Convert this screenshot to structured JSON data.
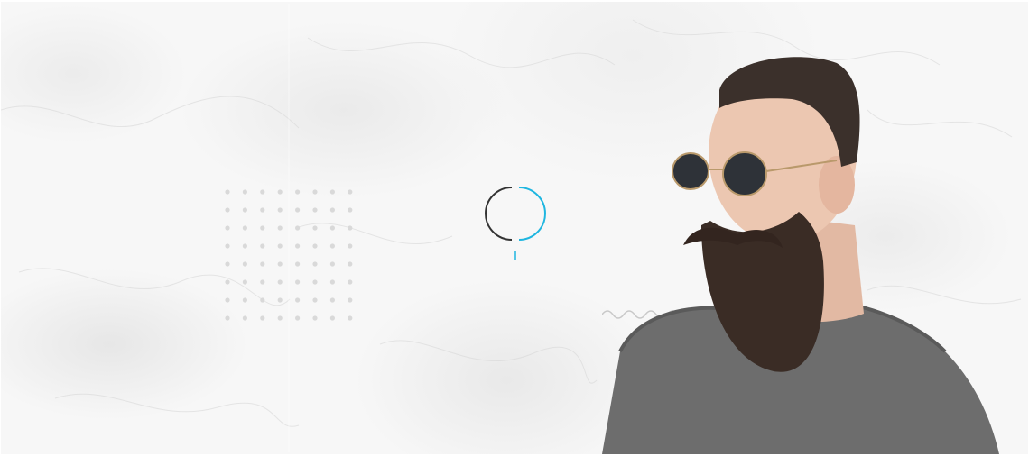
{
  "hero": {
    "accent_color": "#1fb6e0",
    "dot_color": "#d9d9d9",
    "wave_color": "#c9c9c9",
    "loader_dark_color": "#333333",
    "icons": [
      "dot-grid-decoration",
      "loading-spinner-icon",
      "wave-line-decoration",
      "portrait-image"
    ]
  }
}
